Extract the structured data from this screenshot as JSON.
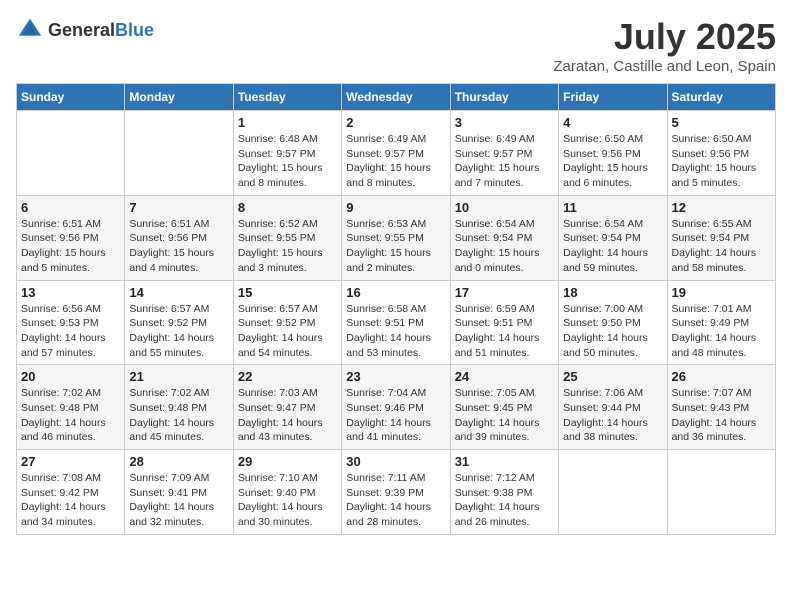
{
  "header": {
    "logo_general": "General",
    "logo_blue": "Blue",
    "month_year": "July 2025",
    "location": "Zaratan, Castille and Leon, Spain"
  },
  "weekdays": [
    "Sunday",
    "Monday",
    "Tuesday",
    "Wednesday",
    "Thursday",
    "Friday",
    "Saturday"
  ],
  "weeks": [
    [
      {
        "day": "",
        "sunrise": "",
        "sunset": "",
        "daylight": ""
      },
      {
        "day": "",
        "sunrise": "",
        "sunset": "",
        "daylight": ""
      },
      {
        "day": "1",
        "sunrise": "Sunrise: 6:48 AM",
        "sunset": "Sunset: 9:57 PM",
        "daylight": "Daylight: 15 hours and 8 minutes."
      },
      {
        "day": "2",
        "sunrise": "Sunrise: 6:49 AM",
        "sunset": "Sunset: 9:57 PM",
        "daylight": "Daylight: 15 hours and 8 minutes."
      },
      {
        "day": "3",
        "sunrise": "Sunrise: 6:49 AM",
        "sunset": "Sunset: 9:57 PM",
        "daylight": "Daylight: 15 hours and 7 minutes."
      },
      {
        "day": "4",
        "sunrise": "Sunrise: 6:50 AM",
        "sunset": "Sunset: 9:56 PM",
        "daylight": "Daylight: 15 hours and 6 minutes."
      },
      {
        "day": "5",
        "sunrise": "Sunrise: 6:50 AM",
        "sunset": "Sunset: 9:56 PM",
        "daylight": "Daylight: 15 hours and 5 minutes."
      }
    ],
    [
      {
        "day": "6",
        "sunrise": "Sunrise: 6:51 AM",
        "sunset": "Sunset: 9:56 PM",
        "daylight": "Daylight: 15 hours and 5 minutes."
      },
      {
        "day": "7",
        "sunrise": "Sunrise: 6:51 AM",
        "sunset": "Sunset: 9:56 PM",
        "daylight": "Daylight: 15 hours and 4 minutes."
      },
      {
        "day": "8",
        "sunrise": "Sunrise: 6:52 AM",
        "sunset": "Sunset: 9:55 PM",
        "daylight": "Daylight: 15 hours and 3 minutes."
      },
      {
        "day": "9",
        "sunrise": "Sunrise: 6:53 AM",
        "sunset": "Sunset: 9:55 PM",
        "daylight": "Daylight: 15 hours and 2 minutes."
      },
      {
        "day": "10",
        "sunrise": "Sunrise: 6:54 AM",
        "sunset": "Sunset: 9:54 PM",
        "daylight": "Daylight: 15 hours and 0 minutes."
      },
      {
        "day": "11",
        "sunrise": "Sunrise: 6:54 AM",
        "sunset": "Sunset: 9:54 PM",
        "daylight": "Daylight: 14 hours and 59 minutes."
      },
      {
        "day": "12",
        "sunrise": "Sunrise: 6:55 AM",
        "sunset": "Sunset: 9:54 PM",
        "daylight": "Daylight: 14 hours and 58 minutes."
      }
    ],
    [
      {
        "day": "13",
        "sunrise": "Sunrise: 6:56 AM",
        "sunset": "Sunset: 9:53 PM",
        "daylight": "Daylight: 14 hours and 57 minutes."
      },
      {
        "day": "14",
        "sunrise": "Sunrise: 6:57 AM",
        "sunset": "Sunset: 9:52 PM",
        "daylight": "Daylight: 14 hours and 55 minutes."
      },
      {
        "day": "15",
        "sunrise": "Sunrise: 6:57 AM",
        "sunset": "Sunset: 9:52 PM",
        "daylight": "Daylight: 14 hours and 54 minutes."
      },
      {
        "day": "16",
        "sunrise": "Sunrise: 6:58 AM",
        "sunset": "Sunset: 9:51 PM",
        "daylight": "Daylight: 14 hours and 53 minutes."
      },
      {
        "day": "17",
        "sunrise": "Sunrise: 6:59 AM",
        "sunset": "Sunset: 9:51 PM",
        "daylight": "Daylight: 14 hours and 51 minutes."
      },
      {
        "day": "18",
        "sunrise": "Sunrise: 7:00 AM",
        "sunset": "Sunset: 9:50 PM",
        "daylight": "Daylight: 14 hours and 50 minutes."
      },
      {
        "day": "19",
        "sunrise": "Sunrise: 7:01 AM",
        "sunset": "Sunset: 9:49 PM",
        "daylight": "Daylight: 14 hours and 48 minutes."
      }
    ],
    [
      {
        "day": "20",
        "sunrise": "Sunrise: 7:02 AM",
        "sunset": "Sunset: 9:48 PM",
        "daylight": "Daylight: 14 hours and 46 minutes."
      },
      {
        "day": "21",
        "sunrise": "Sunrise: 7:02 AM",
        "sunset": "Sunset: 9:48 PM",
        "daylight": "Daylight: 14 hours and 45 minutes."
      },
      {
        "day": "22",
        "sunrise": "Sunrise: 7:03 AM",
        "sunset": "Sunset: 9:47 PM",
        "daylight": "Daylight: 14 hours and 43 minutes."
      },
      {
        "day": "23",
        "sunrise": "Sunrise: 7:04 AM",
        "sunset": "Sunset: 9:46 PM",
        "daylight": "Daylight: 14 hours and 41 minutes."
      },
      {
        "day": "24",
        "sunrise": "Sunrise: 7:05 AM",
        "sunset": "Sunset: 9:45 PM",
        "daylight": "Daylight: 14 hours and 39 minutes."
      },
      {
        "day": "25",
        "sunrise": "Sunrise: 7:06 AM",
        "sunset": "Sunset: 9:44 PM",
        "daylight": "Daylight: 14 hours and 38 minutes."
      },
      {
        "day": "26",
        "sunrise": "Sunrise: 7:07 AM",
        "sunset": "Sunset: 9:43 PM",
        "daylight": "Daylight: 14 hours and 36 minutes."
      }
    ],
    [
      {
        "day": "27",
        "sunrise": "Sunrise: 7:08 AM",
        "sunset": "Sunset: 9:42 PM",
        "daylight": "Daylight: 14 hours and 34 minutes."
      },
      {
        "day": "28",
        "sunrise": "Sunrise: 7:09 AM",
        "sunset": "Sunset: 9:41 PM",
        "daylight": "Daylight: 14 hours and 32 minutes."
      },
      {
        "day": "29",
        "sunrise": "Sunrise: 7:10 AM",
        "sunset": "Sunset: 9:40 PM",
        "daylight": "Daylight: 14 hours and 30 minutes."
      },
      {
        "day": "30",
        "sunrise": "Sunrise: 7:11 AM",
        "sunset": "Sunset: 9:39 PM",
        "daylight": "Daylight: 14 hours and 28 minutes."
      },
      {
        "day": "31",
        "sunrise": "Sunrise: 7:12 AM",
        "sunset": "Sunset: 9:38 PM",
        "daylight": "Daylight: 14 hours and 26 minutes."
      },
      {
        "day": "",
        "sunrise": "",
        "sunset": "",
        "daylight": ""
      },
      {
        "day": "",
        "sunrise": "",
        "sunset": "",
        "daylight": ""
      }
    ]
  ]
}
